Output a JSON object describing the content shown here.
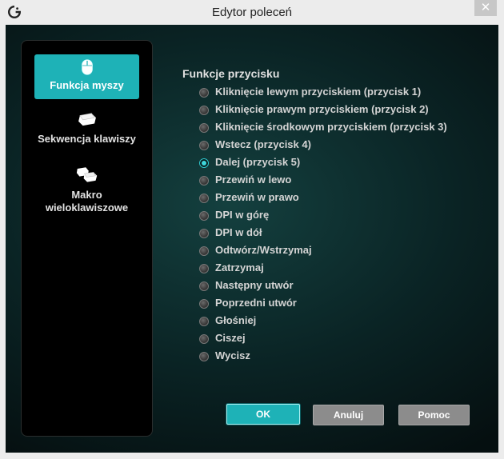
{
  "window": {
    "title": "Edytor poleceń",
    "close_symbol": "✕",
    "logo_icon": "logitech-g-logo"
  },
  "sidebar": {
    "items": [
      {
        "label": "Funkcja myszy",
        "icon": "mouse-icon",
        "active": true
      },
      {
        "label": "Sekwencja klawiszy",
        "icon": "key-icon",
        "active": false
      },
      {
        "label": "Makro wieloklawiszowe",
        "icon": "multi-key-icon",
        "active": false
      }
    ]
  },
  "main": {
    "section_title": "Funkcje przycisku",
    "selected": "Dalej (przycisk 5)",
    "options": [
      "Kliknięcie lewym przyciskiem (przycisk 1)",
      "Kliknięcie prawym przyciskiem (przycisk 2)",
      "Kliknięcie środkowym przyciskiem (przycisk 3)",
      "Wstecz (przycisk 4)",
      "Dalej (przycisk 5)",
      "Przewiń w lewo",
      "Przewiń w prawo",
      "DPI w górę",
      "DPI w dół",
      "Odtwórz/Wstrzymaj",
      "Zatrzymaj",
      "Następny utwór",
      "Poprzedni utwór",
      "Głośniej",
      "Ciszej",
      "Wycisz"
    ]
  },
  "buttons": {
    "ok": "OK",
    "cancel": "Anuluj",
    "help": "Pomoc"
  },
  "colors": {
    "accent": "#1eb2b7",
    "background": "#0a2324",
    "sidebar": "#000000",
    "button_gray": "#8c8c8c"
  }
}
